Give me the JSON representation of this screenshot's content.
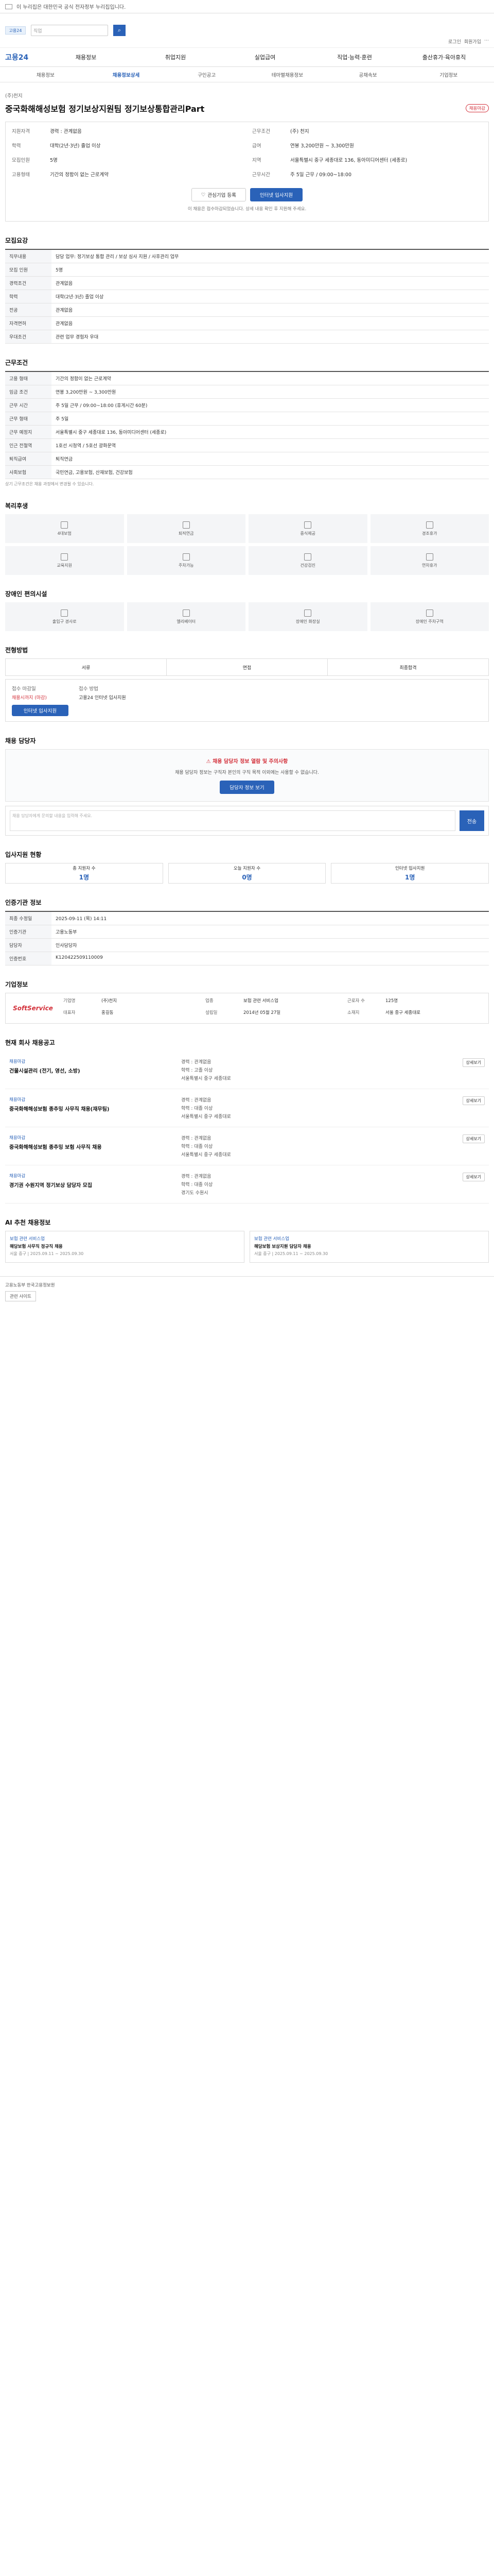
{
  "topbanner": {
    "text": "이 누리집은 대한민국 공식 전자정부 누리집입니다."
  },
  "search": {
    "placeholder": "직업"
  },
  "toplinks": [
    "로그인",
    "회원가입",
    "⋯"
  ],
  "gnb": {
    "home": "고용24",
    "items": [
      "채용정보",
      "취업지원",
      "실업급여",
      "직업·능력·훈련",
      "출산휴가·육아휴직"
    ]
  },
  "subnav": [
    "채용정보",
    "채용정보상세",
    "구인공고",
    "테마별채용정보",
    "공채속보",
    "기업정보"
  ],
  "job": {
    "company": "(주)천지",
    "title": "중국화해해성보험 정기보상지원팀 정기보상통합관리Part",
    "badge": "채용마감",
    "summary": [
      {
        "k": "지원자격",
        "v": "경력 : 관계없음"
      },
      {
        "k": "근무조건",
        "v": "(주) 천지"
      },
      {
        "k": "학력",
        "v": "대학(2년·3년) 졸업 이상"
      },
      {
        "k": "급여",
        "v": "연봉 3,200만원 ~ 3,300만원"
      },
      {
        "k": "모집인원",
        "v": "5명"
      },
      {
        "k": "지역",
        "v": "서울특별시 중구 세종대로 136, 동아미디어센터 (세종로)"
      },
      {
        "k": "고용형태",
        "v": "기간의 정함이 없는 근로계약"
      },
      {
        "k": "근무시간",
        "v": "주 5일 근무 / 09:00~18:00"
      }
    ],
    "btn_interest": "관심기업 등록",
    "btn_apply": "인터넷 입사지원",
    "note": "이 채용은 접수마감되었습니다. 상세 내용 확인 후 지원해 주세요."
  },
  "recruit": {
    "heading": "모집요강",
    "rows": [
      {
        "k": "직무내용",
        "v": "담당 업무: 정기보상 통합 관리 / 보상 심사 지원 / 사후관리 업무"
      },
      {
        "k": "모집 인원",
        "v": "5명"
      },
      {
        "k": "경력조건",
        "v": "관계없음"
      },
      {
        "k": "학력",
        "v": "대학(2년·3년) 졸업 이상"
      },
      {
        "k": "전공",
        "v": "관계없음"
      },
      {
        "k": "자격면허",
        "v": "관계없음"
      },
      {
        "k": "우대조건",
        "v": "관련 업무 경험자 우대"
      }
    ]
  },
  "condition": {
    "heading": "근무조건",
    "rows": [
      {
        "k": "고용 형태",
        "v": "기간의 정함이 없는 근로계약"
      },
      {
        "k": "임금 조건",
        "v": "연봉 3,200만원 ~ 3,300만원"
      },
      {
        "k": "근무 시간",
        "v": "주 5일 근무 / 09:00~18:00 (휴게시간 60분)"
      },
      {
        "k": "근무 형태",
        "v": "주 5일"
      },
      {
        "k": "근무 예정지",
        "v": "서울특별시 중구 세종대로 136, 동아미디어센터 (세종로)"
      },
      {
        "k": "인근 전철역",
        "v": "1호선 시청역 / 5호선 광화문역"
      },
      {
        "k": "퇴직급여",
        "v": "퇴직연금"
      },
      {
        "k": "사회보험",
        "v": "국민연금, 고용보험, 산재보험, 건강보험"
      }
    ],
    "note": "상기 근무조건은 채용 과정에서 변경될 수 있습니다."
  },
  "welfare": {
    "heading": "복리후생",
    "items": [
      "4대보험",
      "퇴직연금",
      "중식제공",
      "경조휴가",
      "교육지원",
      "주차가능",
      "건강검진",
      "연차휴가"
    ]
  },
  "facility": {
    "heading": "장애인 편의시설",
    "items": [
      "출입구 경사로",
      "엘리베이터",
      "장애인 화장실",
      "장애인 주차구역"
    ]
  },
  "screening": {
    "heading": "전형방법",
    "steps": [
      "서류",
      "면접",
      "최종합격"
    ],
    "apply_period_label": "접수 마감일",
    "apply_period": "채용시까지 (마감)",
    "apply_method_label": "접수 방법",
    "apply_method": "고용24 인터넷 입사지원",
    "apply_btn": "인터넷 입사지원"
  },
  "contact": {
    "heading": "채용 담당자",
    "alert": "채용 담당자 정보 열람 및 주의사항",
    "text": "채용 담당자 정보는 구직자 본인의 구직 목적 이외에는 사용할 수 없습니다.",
    "btn": "담당자 정보 보기",
    "chat_placeholder": "채용 담당자에게 문의할 내용을 입력해 주세요.",
    "send": "전송"
  },
  "stats": {
    "heading": "입사지원 현황",
    "items": [
      {
        "label": "총 지원자 수",
        "value": "1명"
      },
      {
        "label": "오늘 지원자 수",
        "value": "0명"
      },
      {
        "label": "인터넷 입사지원",
        "value": "1명"
      }
    ]
  },
  "info": {
    "heading": "인증기관 정보",
    "rows": [
      {
        "k": "최종 수정일",
        "v": "2025-09-11 (목) 14:11"
      },
      {
        "k": "인증기관",
        "v": "고용노동부"
      },
      {
        "k": "담당자",
        "v": "인사담당자"
      },
      {
        "k": "인증번호",
        "v": "K120422509110009"
      }
    ]
  },
  "companyinfo": {
    "heading": "기업정보",
    "logo": "SoftService",
    "rows": [
      {
        "k": "기업명",
        "v": "(주)천지"
      },
      {
        "k": "업종",
        "v": "보험 관련 서비스업"
      },
      {
        "k": "근로자 수",
        "v": "125명"
      },
      {
        "k": "대표자",
        "v": "홍길동"
      },
      {
        "k": "설립일",
        "v": "2014년 05월 27일"
      },
      {
        "k": "소재지",
        "v": "서울 중구 세종대로"
      }
    ]
  },
  "otherjobs": {
    "heading": "현재 회사 채용공고",
    "jobs": [
      {
        "cat": "채용마감",
        "title": "건물시설관리 (전기, 영선, 소방)",
        "info": [
          "경력 : 관계없음",
          "학력 : 고졸 이상",
          "서울특별시 중구 세종대로"
        ]
      },
      {
        "cat": "채용마감",
        "title": "중국화해해성보험 종추밍 사무직 채용(재무팀)",
        "info": [
          "경력 : 관계없음",
          "학력 : 대졸 이상",
          "서울특별시 중구 세종대로"
        ]
      },
      {
        "cat": "채용마감",
        "title": "중국화해해성보험 종추밍 보험 사무직 채용",
        "info": [
          "경력 : 관계없음",
          "학력 : 대졸 이상",
          "서울특별시 중구 세종대로"
        ]
      },
      {
        "cat": "채용마감",
        "title": "경기권 수원지역 정기보상 담당자 모집",
        "info": [
          "경력 : 관계없음",
          "학력 : 대졸 이상",
          "경기도 수원시"
        ]
      }
    ],
    "btn": "상세보기"
  },
  "recommend": {
    "heading": "AI 추천 채용정보",
    "cards": [
      {
        "cat": "보험 관련 서비스업",
        "title": "해당보험 사무직 정규직 채용",
        "d": "서울 중구 | 2025.09.11 ~ 2025.09.30"
      },
      {
        "cat": "보험 관련 서비스업",
        "title": "해당보험 보상지원 담당자 채용",
        "d": "서울 중구 | 2025.09.11 ~ 2025.09.30"
      }
    ]
  },
  "footer": {
    "line1": "고용노동부 한국고용정보원",
    "line2": "관련 사이트"
  }
}
